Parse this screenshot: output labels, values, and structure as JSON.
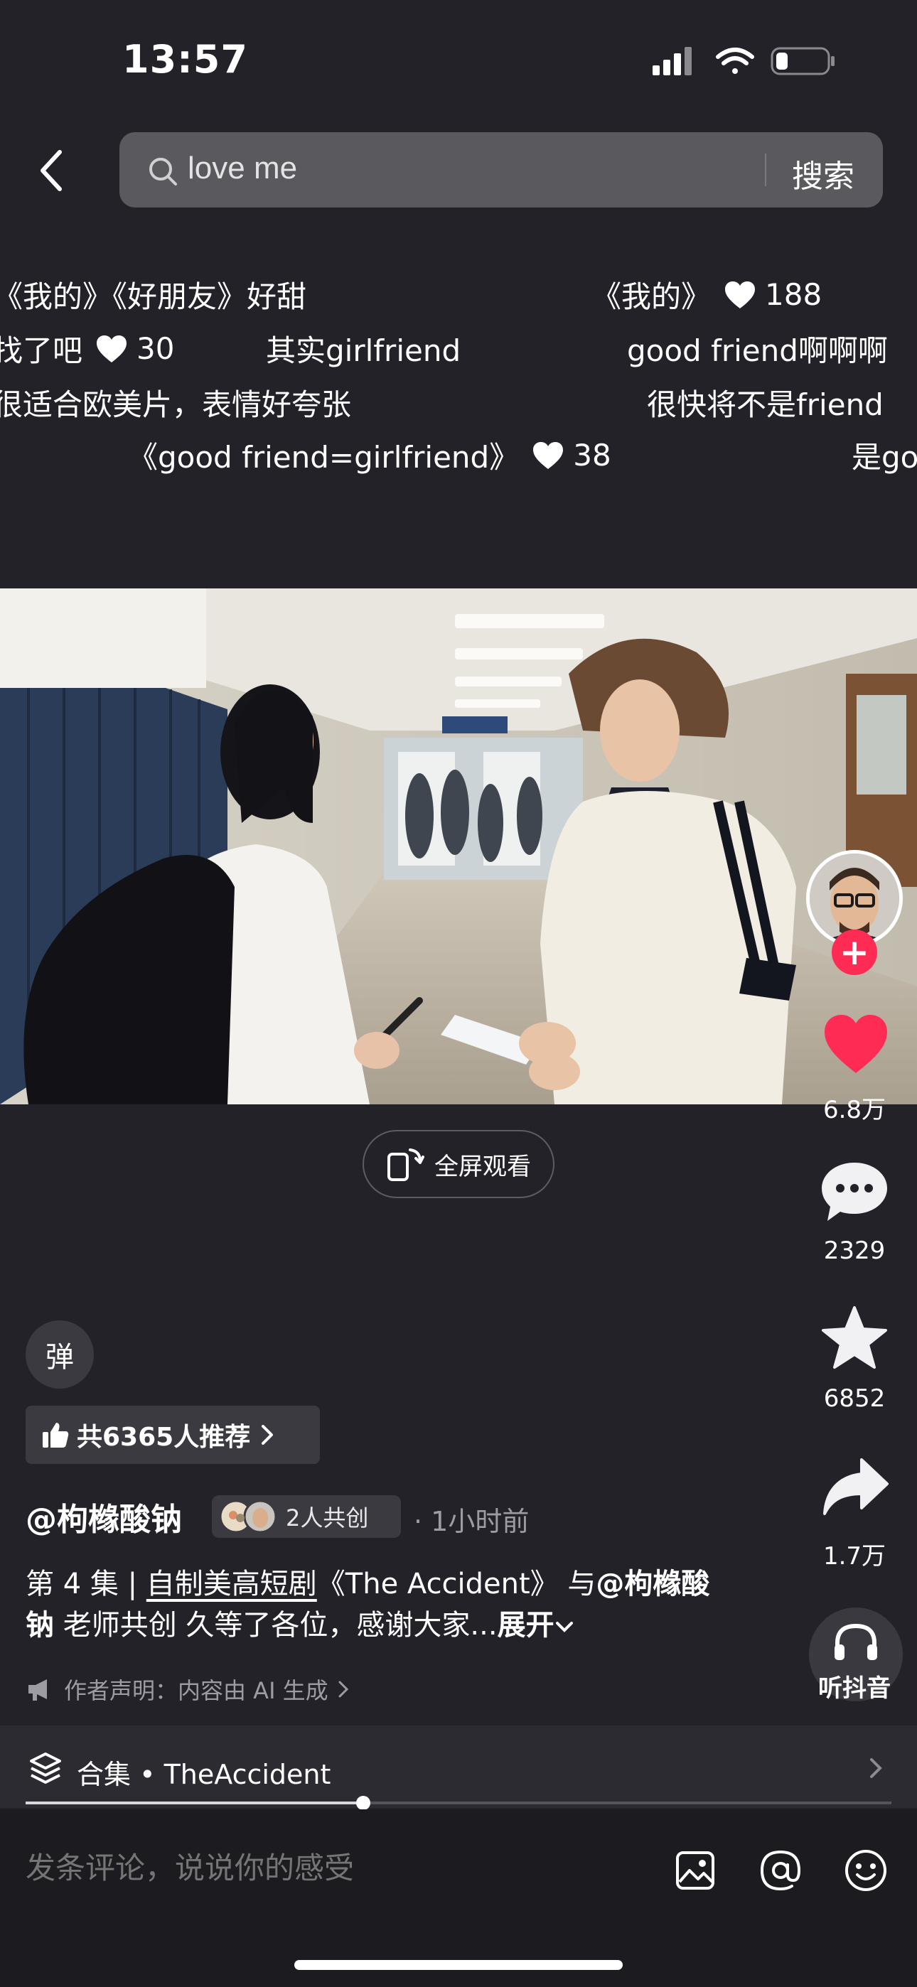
{
  "status_bar": {
    "time": "13:57"
  },
  "search": {
    "query": "love me",
    "button": "搜索"
  },
  "danmaku": [
    {
      "text": "《我的》《好朋友》好甜",
      "likes": ""
    },
    {
      "text": "《我的》",
      "likes": "188"
    },
    {
      "text": "找了吧",
      "likes": "30"
    },
    {
      "text": "其实girlfriend",
      "likes": ""
    },
    {
      "text": "good friend啊啊啊",
      "likes": ""
    },
    {
      "text": "很适合欧美片，表情好夸张",
      "likes": ""
    },
    {
      "text": "很快将不是friend",
      "likes": ""
    },
    {
      "text": "《good friend=girlfriend》",
      "likes": "38"
    },
    {
      "text": "是go",
      "likes": ""
    }
  ],
  "video": {
    "fullscreen_label": "全屏观看"
  },
  "rail": {
    "follow_symbol": "+",
    "likes": "6.8万",
    "comments": "2329",
    "favorites": "6852",
    "shares": "1.7万",
    "listen": "听抖音"
  },
  "info": {
    "danmu_toggle": "弹",
    "recommend": "共6365人推荐",
    "author": "@枸橼酸钠",
    "cocreate": "2人共创",
    "time_ago": "· 1小时前",
    "desc_prefix": "第 4 集 | ",
    "desc_link": "自制美高短剧",
    "desc_middle": "《The Accident》 与",
    "desc_mention": "@枸橼酸钠",
    "desc_rest": " 老师共创 久等了各位，感谢大家...",
    "expand": "展开",
    "ai_notice": "作者声明：内容由 AI 生成"
  },
  "collection": {
    "label": "合集 • TheAccident",
    "progress": 0.39
  },
  "comment": {
    "placeholder": "发条评论，说说你的感受"
  },
  "colors": {
    "accent": "#fe2c55",
    "background": "#232228"
  }
}
